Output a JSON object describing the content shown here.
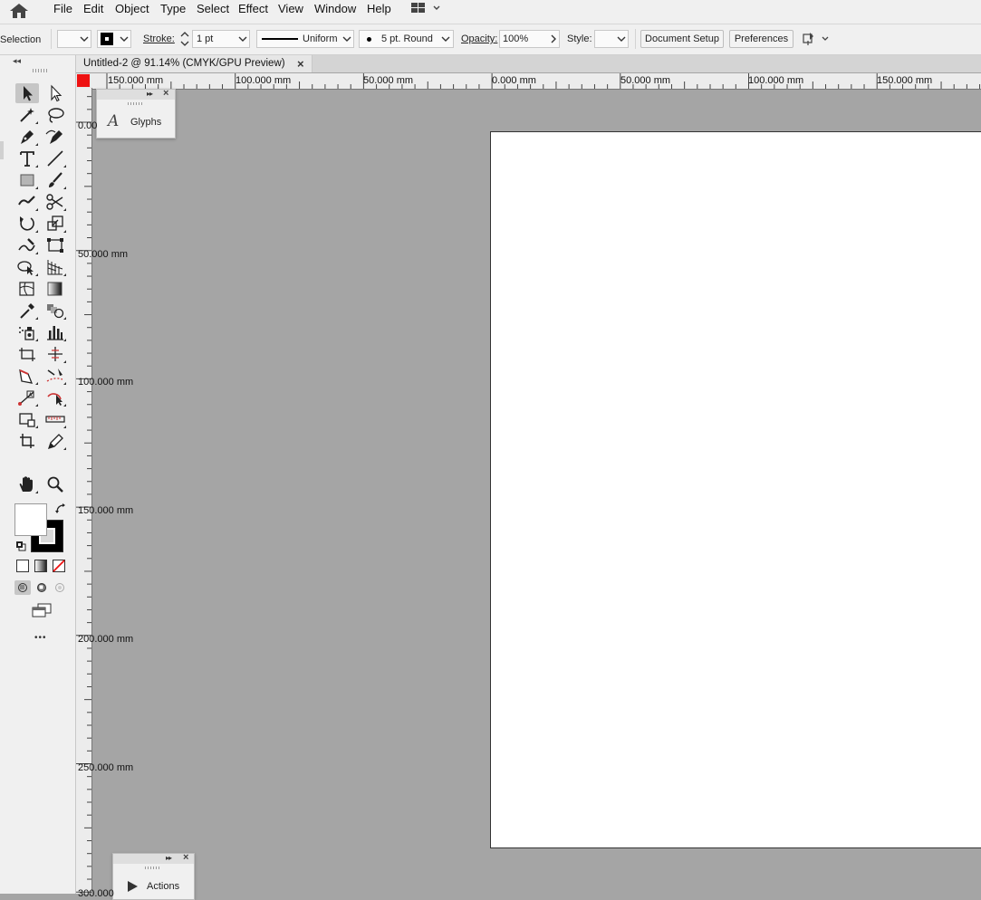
{
  "menubar": {
    "items": [
      "File",
      "Edit",
      "Object",
      "Type",
      "Select",
      "Effect",
      "View",
      "Window",
      "Help"
    ]
  },
  "controlbar": {
    "selection_label": "Selection",
    "stroke_label": "Stroke:",
    "stroke_weight": "1 pt",
    "profile": "Uniform",
    "brush": "5 pt. Round",
    "opacity_label": "Opacity:",
    "opacity_value": "100%",
    "style_label": "Style:",
    "document_setup": "Document Setup",
    "preferences": "Preferences"
  },
  "document": {
    "tab_title": "Untitled-2 @ 91.14% (CMYK/GPU Preview)",
    "close": "×"
  },
  "rulers": {
    "horizontal": [
      "150.000 mm",
      "100.000 mm",
      "50.000 mm",
      "0.000 mm",
      "50.000 mm",
      "100.000 mm",
      "150.000 mm"
    ],
    "vertical": [
      "0.00",
      "50.000 mm",
      "100.000 mm",
      "150.000 mm",
      "200.000 mm",
      "250.000 mm",
      "300.000"
    ]
  },
  "panels": {
    "glyphs": {
      "label": "Glyphs",
      "icon": "glyphs-icon"
    },
    "actions": {
      "label": "Actions",
      "icon": "play-icon"
    }
  },
  "toolbar": {
    "collapse": "◂◂",
    "more": "•••",
    "tools": [
      "selection-tool",
      "direct-selection-tool",
      "magic-wand-tool",
      "lasso-tool",
      "pen-tool",
      "curvature-tool",
      "type-tool",
      "line-segment-tool",
      "rectangle-tool",
      "paintbrush-tool",
      "shaper-tool",
      "scissors-tool",
      "rotate-tool",
      "scale-tool",
      "warp-tool",
      "free-transform-tool",
      "shape-builder-tool",
      "perspective-grid-tool",
      "mesh-tool",
      "gradient-tool",
      "eyedropper-tool",
      "blend-tool",
      "symbol-sprayer-tool",
      "column-graph-tool",
      "artboard-tool",
      "slice-tool",
      "eraser-tool",
      "knife-tool",
      "puppet-warp-tool",
      "reshape-tool",
      "scatter-tool",
      "ruler-tool",
      "crop-tool",
      "pencil-tool",
      "hand-tool",
      "zoom-tool"
    ]
  },
  "colors": {
    "canvas": "#a5a5a5",
    "chrome": "#f0f0f0",
    "ruler_origin": "#ee1111"
  }
}
